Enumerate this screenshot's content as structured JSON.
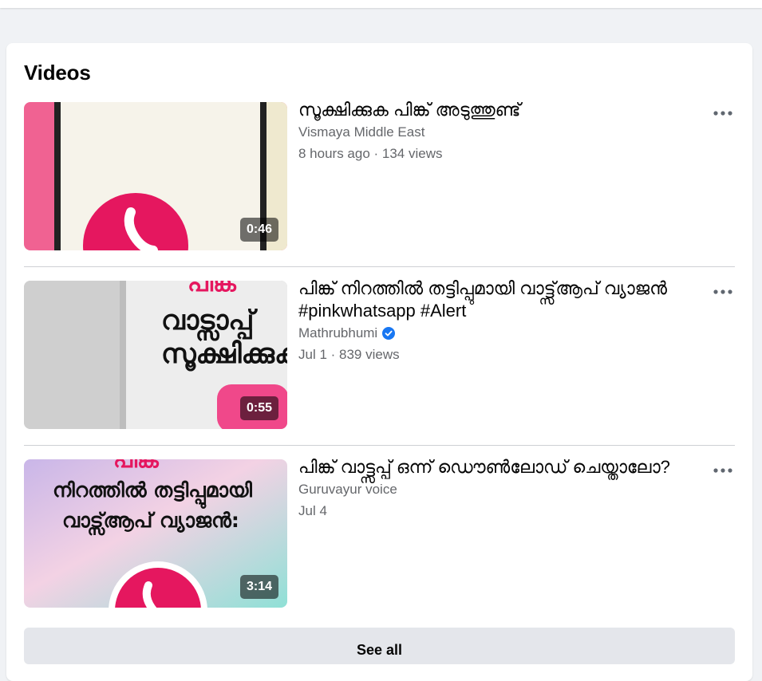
{
  "section_title": "Videos",
  "videos": [
    {
      "title": "സൂക്ഷിക്കുക പിങ്ക് അടുത്തുണ്ട്",
      "channel": "Vismaya Middle East",
      "verified": false,
      "meta": "8 hours ago · 134 views",
      "duration": "0:46",
      "thumb_text": []
    },
    {
      "title": "പിങ്ക് നിറത്തിൽ തട്ടിപ്പുമായി വാട്ട്സ്ആപ് വ്യാജൻ #pinkwhatsapp #Alert",
      "channel": "Mathrubhumi",
      "verified": true,
      "meta": "Jul 1 · 839 views",
      "duration": "0:55",
      "thumb_text": [
        "പിങ്ക്",
        "വാട്സാപ്പ്",
        "സൂക്ഷിക്കുക"
      ]
    },
    {
      "title": "പിങ്ക് വാട്ട്സപ്പ് ഒന്ന് ഡൌൺലോഡ് ചെയ്താലോ?",
      "channel": "Guruvayur voice",
      "verified": false,
      "meta": "Jul 4",
      "duration": "3:14",
      "thumb_text": [
        "പിങ്ക്",
        "നിറത്തിൽ തട്ടിപ്പുമായി",
        "വാട്സ്ആപ് വ്യാജൻ:"
      ]
    }
  ],
  "see_all_label": "See all",
  "colors": {
    "page_bg": "#f0f2f5",
    "card_bg": "#ffffff",
    "secondary_text": "#65676b",
    "button_bg": "#e4e6eb",
    "verified_blue": "#1877f2",
    "pink": "#e5175f"
  }
}
